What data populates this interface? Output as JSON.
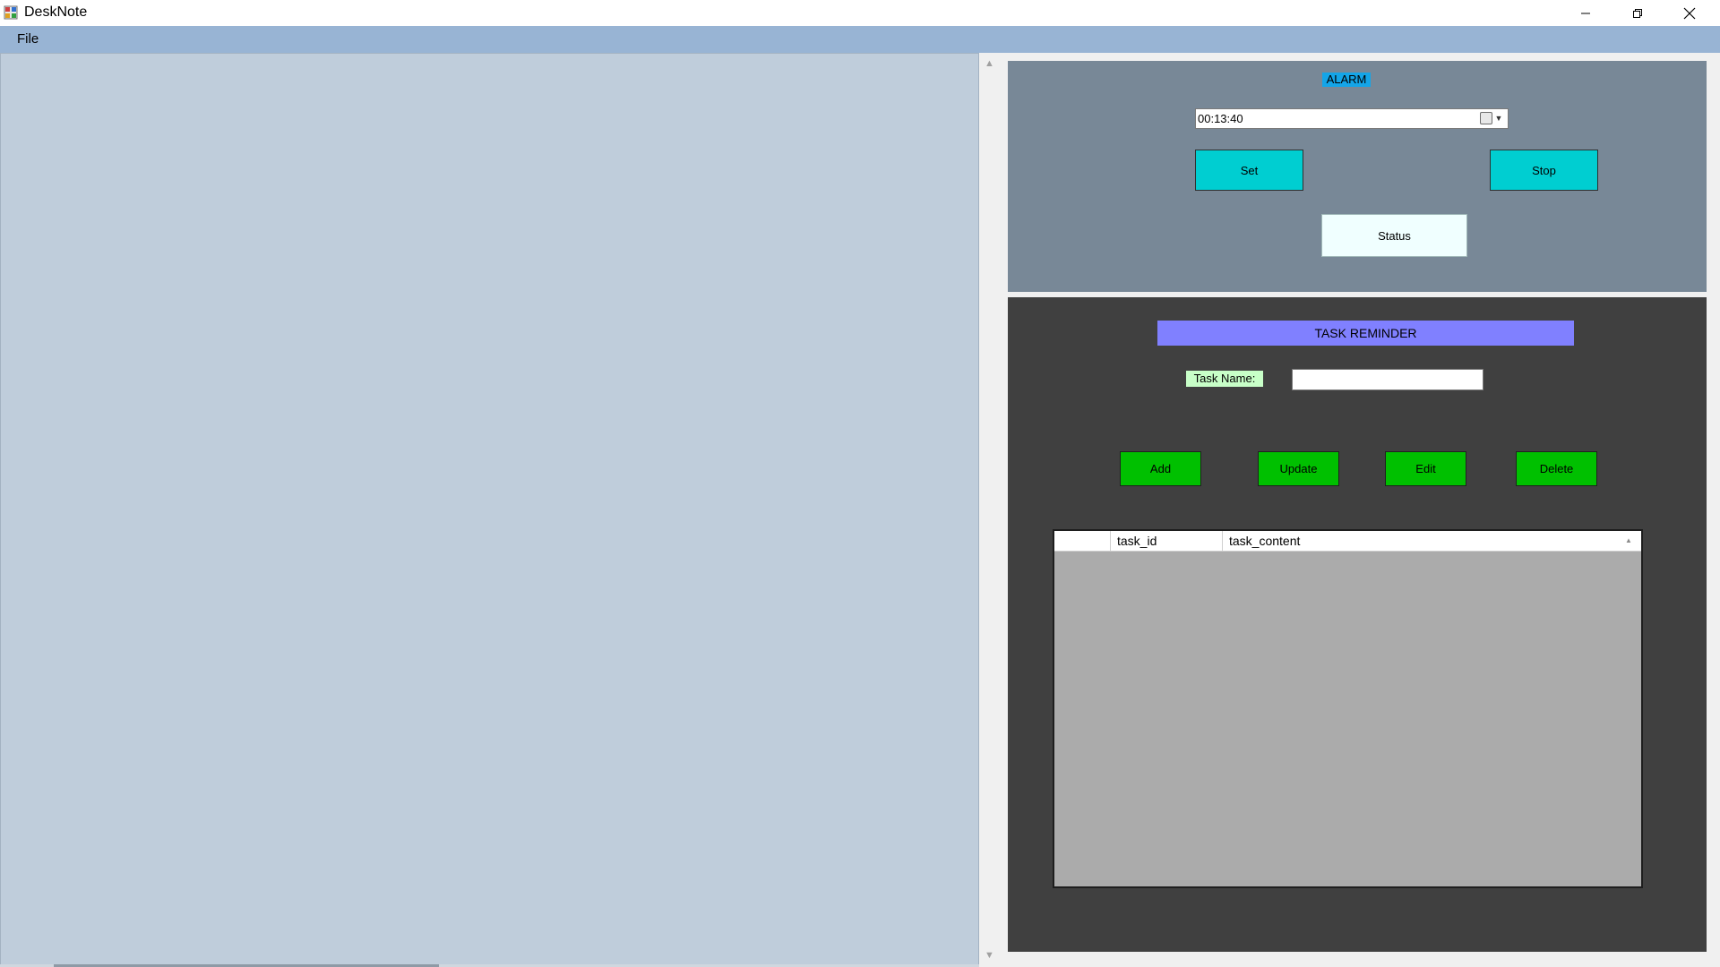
{
  "window": {
    "title": "DeskNote",
    "icon": "desknote-app-icon",
    "controls": {
      "minimize": "minimize-icon",
      "restore": "restore-icon",
      "close": "close-icon"
    }
  },
  "menu": {
    "file": "File"
  },
  "alarm": {
    "label": "ALARM",
    "time_value": "00:13:40",
    "set_label": "Set",
    "stop_label": "Stop",
    "status_text": "Status"
  },
  "task": {
    "title": "TASK REMINDER",
    "name_label": "Task Name:",
    "name_value": "",
    "add_label": "Add",
    "update_label": "Update",
    "edit_label": "Edit",
    "delete_label": "Delete",
    "grid": {
      "columns": [
        "",
        "task_id",
        "task_content"
      ],
      "rows": []
    }
  },
  "colors": {
    "menubar": "#98b4d4",
    "note_area": "#bfcddb",
    "alarm_panel": "#788897",
    "alarm_label_bg": "#14a5e8",
    "cyan_button": "#00ced1",
    "status_bg": "#f0ffff",
    "task_panel": "#404040",
    "task_title_bg": "#8080ff",
    "task_label_bg": "#c8ffc8",
    "green_button": "#00c000",
    "grid_bg": "#ababab"
  }
}
